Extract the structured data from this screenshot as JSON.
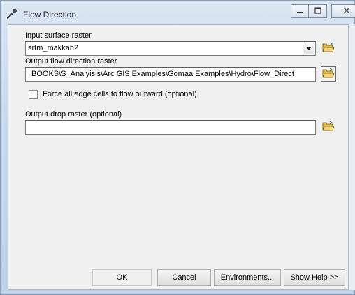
{
  "window": {
    "title": "Flow Direction",
    "icon": "hammer-icon",
    "controls": [
      "minimize-icon",
      "maximize-icon",
      "close-icon"
    ]
  },
  "form": {
    "input_surface_label": "Input surface raster",
    "input_surface_value": "srtm_makkah2",
    "output_flow_label": "Output flow direction raster",
    "output_flow_value": "BOOKS\\S_Analyisis\\Arc GIS Examples\\Gomaa Examples\\Hydro\\Flow_Direct",
    "force_edge_label": "Force all edge cells to flow outward (optional)",
    "force_edge_checked": false,
    "output_drop_label": "Output drop raster (optional)",
    "output_drop_value": ""
  },
  "buttons": {
    "ok": "OK",
    "cancel": "Cancel",
    "environments": "Environments...",
    "show_help": "Show Help >>"
  },
  "colors": {
    "title_bg": "#c9d9ec",
    "client_bg": "#f0f0f0",
    "folder": "#e8b84a"
  }
}
